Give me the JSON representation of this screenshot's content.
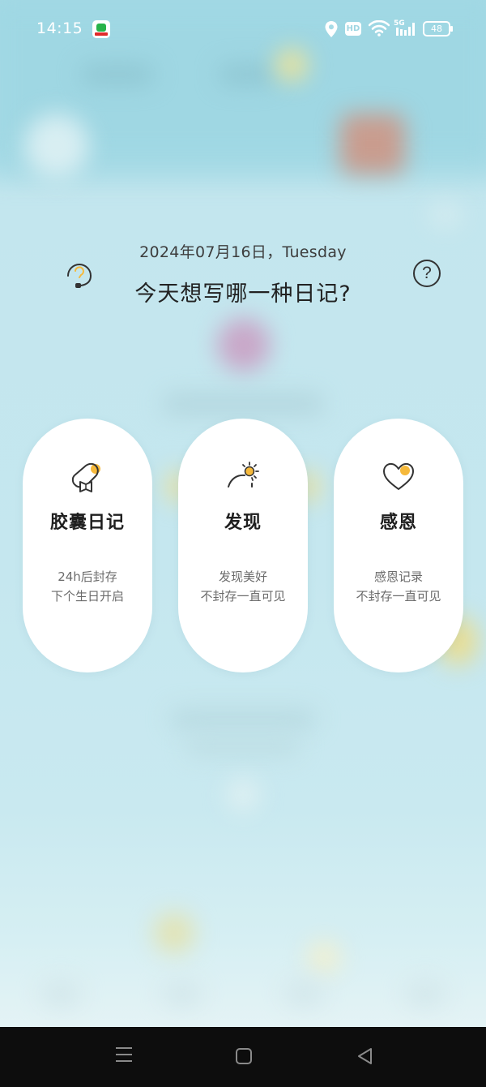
{
  "status_bar": {
    "time": "14:15",
    "network": "5G",
    "hd_label": "HD",
    "battery": "48"
  },
  "header": {
    "date": "2024年07月16日，Tuesday",
    "question": "今天想写哪一种日记?",
    "help_symbol": "?"
  },
  "cards": [
    {
      "title": "胶囊日记",
      "line1": "24h后封存",
      "line2": "下个生日开启",
      "icon": "capsule-book-icon"
    },
    {
      "title": "发现",
      "line1": "发现美好",
      "line2": "不封存一直可见",
      "icon": "sunrise-icon"
    },
    {
      "title": "感恩",
      "line1": "感恩记录",
      "line2": "不封存一直可见",
      "icon": "heart-icon"
    }
  ],
  "colors": {
    "accent": "#f6b93b",
    "background": "#c6e7ee",
    "card": "#ffffff",
    "navbar": "#0d0d0d"
  }
}
